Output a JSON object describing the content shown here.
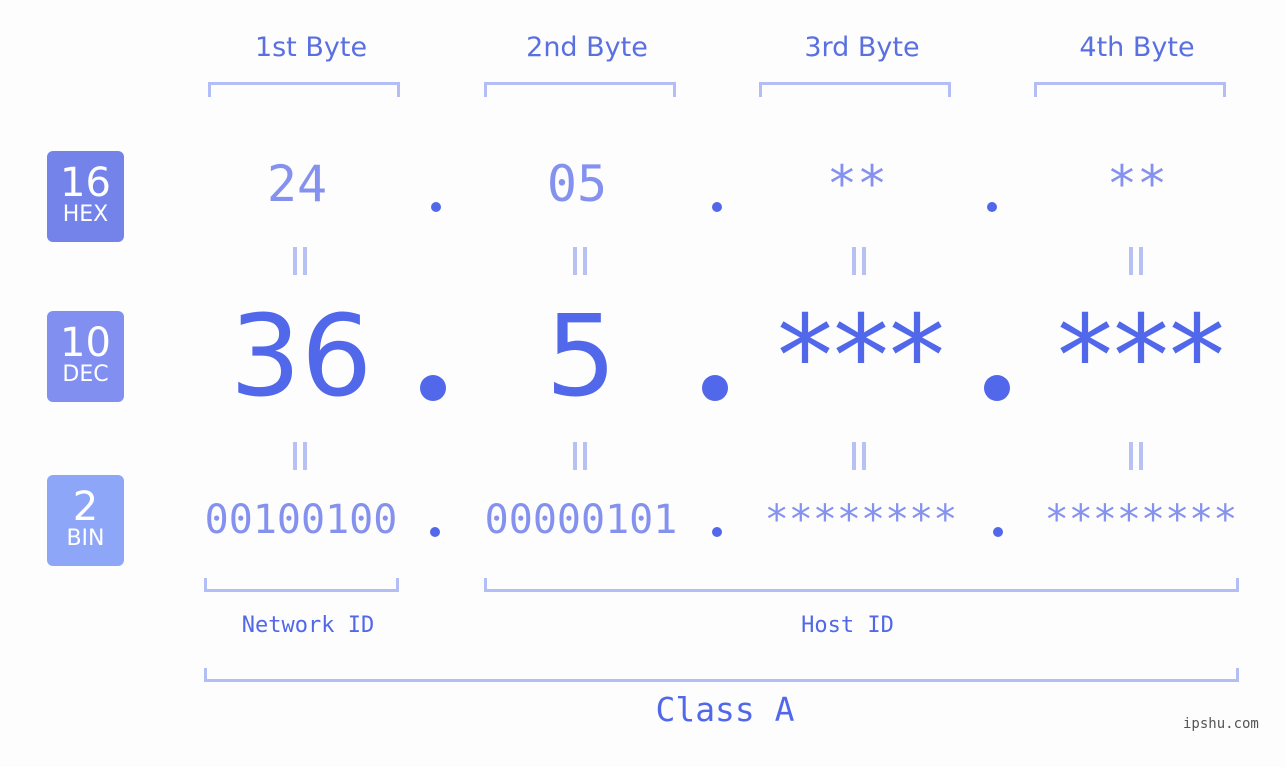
{
  "bytes": {
    "headers": [
      "1st Byte",
      "2nd Byte",
      "3rd Byte",
      "4th Byte"
    ]
  },
  "badges": {
    "hex": {
      "num": "16",
      "label": "HEX",
      "color": "#7383ea"
    },
    "dec": {
      "num": "10",
      "label": "DEC",
      "color": "#8190f0"
    },
    "bin": {
      "num": "2",
      "label": "BIN",
      "color": "#8ea6f8"
    }
  },
  "values": {
    "hex": [
      "24",
      "05",
      "**",
      "**"
    ],
    "dec": [
      "36",
      "5",
      "***",
      "***"
    ],
    "bin": [
      "00100100",
      "00000101",
      "********",
      "********"
    ]
  },
  "labels": {
    "network_id": "Network ID",
    "host_id": "Host ID",
    "class": "Class A"
  },
  "watermark": "ipshu.com",
  "colors": {
    "primary": "#5268ea",
    "secondary": "#8591ef",
    "bracket": "#b3bdf6",
    "background": "#fcfdfc"
  }
}
